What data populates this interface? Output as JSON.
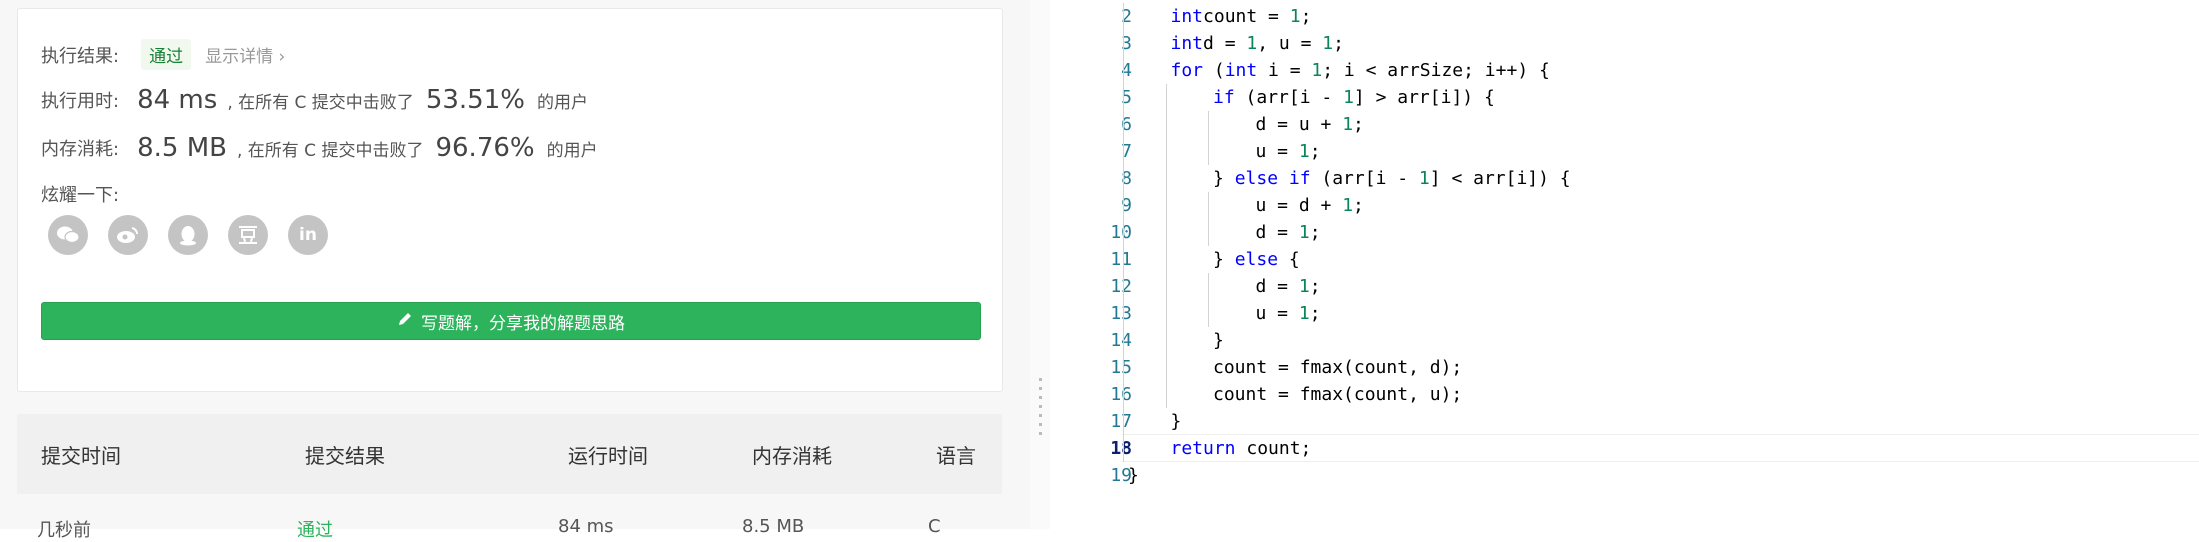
{
  "result": {
    "exec_result_label": "执行结果:",
    "status": "通过",
    "show_detail": "显示详情",
    "time_label": "执行用时:",
    "time_value": "84 ms",
    "time_prefix": ", 在所有 C 提交中击败了",
    "time_percent": "53.51%",
    "time_suffix": "的用户",
    "mem_label": "内存消耗:",
    "mem_value": "8.5 MB",
    "mem_prefix": ", 在所有 C 提交中击败了",
    "mem_percent": "96.76%",
    "mem_suffix": "的用户",
    "share_label": "炫耀一下:",
    "social_icons": [
      "wechat-icon",
      "weibo-icon",
      "qq-icon",
      "douban-icon",
      "linkedin-icon"
    ],
    "write_button": "写题解，分享我的解题思路"
  },
  "table": {
    "headers": [
      "提交时间",
      "提交结果",
      "运行时间",
      "内存消耗",
      "语言"
    ],
    "row": [
      "几秒前",
      "通过",
      "84 ms",
      "8.5 MB",
      "C"
    ]
  },
  "editor": {
    "lines": [
      {
        "n": "2",
        "indent": 1,
        "tokens": [
          [
            "kw",
            "int"
          ],
          [
            "",
            "count = "
          ],
          [
            "num",
            "1"
          ],
          [
            "",
            ";"
          ]
        ]
      },
      {
        "n": "3",
        "indent": 1,
        "tokens": [
          [
            "kw",
            "int"
          ],
          [
            "",
            "d = "
          ],
          [
            "num",
            "1"
          ],
          [
            "",
            ", u = "
          ],
          [
            "num",
            "1"
          ],
          [
            "",
            ";"
          ]
        ]
      },
      {
        "n": "4",
        "indent": 1,
        "tokens": [
          [
            "kw",
            "for"
          ],
          [
            "",
            " ("
          ],
          [
            "kw",
            "int"
          ],
          [
            "",
            " i = "
          ],
          [
            "num",
            "1"
          ],
          [
            "",
            "; i < arrSize; i++) {"
          ]
        ]
      },
      {
        "n": "5",
        "indent": 2,
        "tokens": [
          [
            "kw",
            "if"
          ],
          [
            "",
            " (arr[i - "
          ],
          [
            "num",
            "1"
          ],
          [
            "",
            "] > arr[i]) {"
          ]
        ]
      },
      {
        "n": "6",
        "indent": 3,
        "tokens": [
          [
            "",
            "d = u + "
          ],
          [
            "num",
            "1"
          ],
          [
            "",
            ";"
          ]
        ]
      },
      {
        "n": "7",
        "indent": 3,
        "tokens": [
          [
            "",
            "u = "
          ],
          [
            "num",
            "1"
          ],
          [
            "",
            ";"
          ]
        ]
      },
      {
        "n": "8",
        "indent": 2,
        "tokens": [
          [
            "",
            "} "
          ],
          [
            "kw",
            "else if"
          ],
          [
            "",
            " (arr[i - "
          ],
          [
            "num",
            "1"
          ],
          [
            "",
            "] < arr[i]) {"
          ]
        ]
      },
      {
        "n": "9",
        "indent": 3,
        "tokens": [
          [
            "",
            "u = d + "
          ],
          [
            "num",
            "1"
          ],
          [
            "",
            ";"
          ]
        ]
      },
      {
        "n": "10",
        "indent": 3,
        "tokens": [
          [
            "",
            "d = "
          ],
          [
            "num",
            "1"
          ],
          [
            "",
            ";"
          ]
        ]
      },
      {
        "n": "11",
        "indent": 2,
        "tokens": [
          [
            "",
            "} "
          ],
          [
            "kw",
            "else"
          ],
          [
            "",
            " {"
          ]
        ]
      },
      {
        "n": "12",
        "indent": 3,
        "tokens": [
          [
            "",
            "d = "
          ],
          [
            "num",
            "1"
          ],
          [
            "",
            ";"
          ]
        ]
      },
      {
        "n": "13",
        "indent": 3,
        "tokens": [
          [
            "",
            "u = "
          ],
          [
            "num",
            "1"
          ],
          [
            "",
            ";"
          ]
        ]
      },
      {
        "n": "14",
        "indent": 2,
        "tokens": [
          [
            "",
            "}"
          ]
        ]
      },
      {
        "n": "15",
        "indent": 2,
        "tokens": [
          [
            "",
            "count = fmax(count, d);"
          ]
        ]
      },
      {
        "n": "16",
        "indent": 2,
        "tokens": [
          [
            "",
            "count = fmax(count, u);"
          ]
        ]
      },
      {
        "n": "17",
        "indent": 1,
        "tokens": [
          [
            "",
            "}"
          ]
        ]
      },
      {
        "n": "18",
        "indent": 1,
        "tokens": [
          [
            "kw",
            "return"
          ],
          [
            "",
            " count;"
          ]
        ]
      },
      {
        "n": "19",
        "indent": 0,
        "tokens": [
          [
            "",
            "}"
          ]
        ]
      }
    ],
    "current_line": "18"
  },
  "colors": {
    "accent_green": "#2cb35b",
    "keyword": "#0000ff",
    "number": "#098658",
    "line_number": "#237893"
  }
}
